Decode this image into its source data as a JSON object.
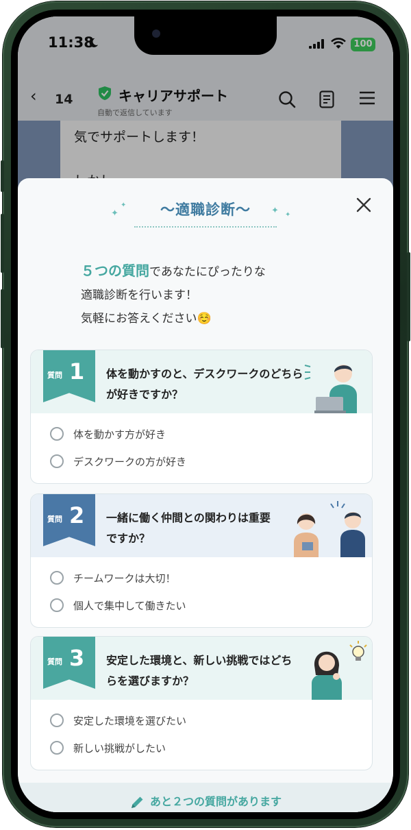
{
  "status_bar": {
    "time": "11:38",
    "battery": "100"
  },
  "chat_header": {
    "back_count": "14",
    "title": "キャリアサポート",
    "subtitle": "自動で返信しています"
  },
  "chat_bubble": {
    "line1": "気でサポートします！",
    "line2": "しかし、、、"
  },
  "modal": {
    "title": "～適職診断～",
    "intro_highlight": "５つの質問",
    "intro_line1_rest": "であなたにぴったりな",
    "intro_line2": "適職診断を行います！",
    "intro_line3": "気軽にお答えください☺️"
  },
  "questions": [
    {
      "label": "質問",
      "number": "1",
      "text": "体を動かすのと、デスクワークのどちらが好きですか？",
      "options": [
        "体を動かす方が好き",
        "デスクワークの方が好き"
      ]
    },
    {
      "label": "質問",
      "number": "2",
      "text": "一緒に働く仲間との関わりは重要ですか？",
      "options": [
        "チームワークは大切！",
        "個人で集中して働きたい"
      ]
    },
    {
      "label": "質問",
      "number": "3",
      "text": "安定した環境と、新しい挑戦ではどちらを選びますか？",
      "options": [
        "安定した環境を選びたい",
        "新しい挑戦がしたい"
      ]
    }
  ],
  "footer": {
    "text": "あと２つの質問があります"
  },
  "colors": {
    "teal": "#4aa79f",
    "blue": "#4a78a6",
    "title_blue": "#3f7ba0",
    "battery_green": "#3ecb5c",
    "frame_green": "#223a29"
  }
}
